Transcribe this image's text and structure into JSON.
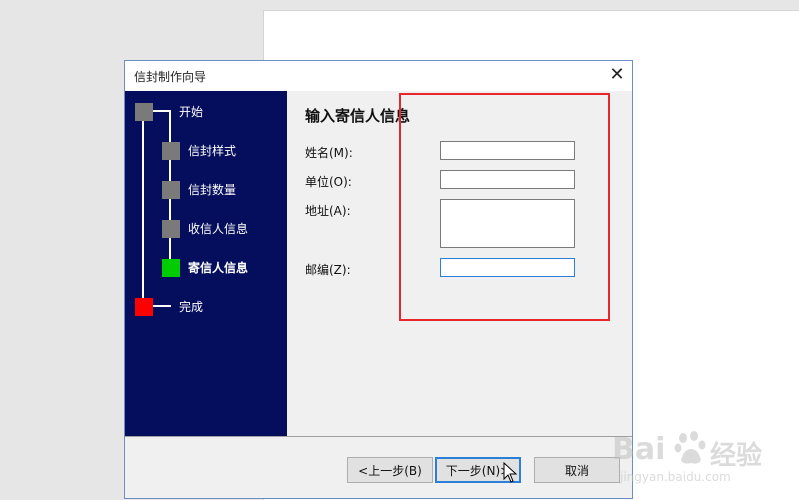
{
  "dialog": {
    "title": "信封制作向导",
    "close_symbol": "✕"
  },
  "steps": [
    {
      "label": "开始",
      "marker": "gray",
      "active": false
    },
    {
      "label": "信封样式",
      "marker": "gray",
      "active": false
    },
    {
      "label": "信封数量",
      "marker": "gray",
      "active": false
    },
    {
      "label": "收信人信息",
      "marker": "gray",
      "active": false
    },
    {
      "label": "寄信人信息",
      "marker": "green",
      "active": true
    },
    {
      "label": "完成",
      "marker": "red",
      "active": false
    }
  ],
  "content": {
    "section_title": "输入寄信人信息",
    "fields": [
      {
        "label": "姓名(M):",
        "value": ""
      },
      {
        "label": "单位(O):",
        "value": ""
      },
      {
        "label": "地址(A):",
        "value": ""
      },
      {
        "label": "邮编(Z):",
        "value": ""
      }
    ]
  },
  "buttons": {
    "back": "<上一步(B)",
    "next": "下一步(N)>",
    "cancel": "取消"
  },
  "watermark": {
    "logo_left": "Bai",
    "logo_right": "经验",
    "sub": "jingyan.baidu.com"
  },
  "colors": {
    "sidebar_bg": "#050e5c",
    "active_step": "#00cc00",
    "finish_step": "#ff0000",
    "pending_step": "#7a7a7a",
    "annotation_box": "#e8262b",
    "focus_border": "#2b7fd6"
  }
}
